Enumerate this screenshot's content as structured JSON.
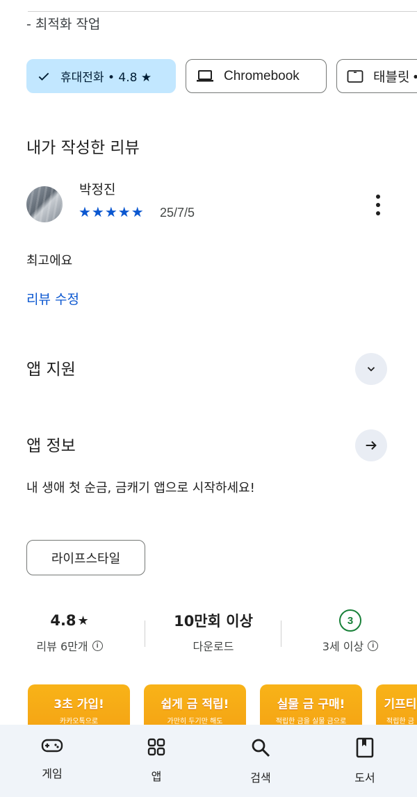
{
  "top_text": "- 최적화 작업",
  "device_chips": [
    {
      "label": "휴대전화 • 4.8 ★",
      "selected": true,
      "icon": "check-icon"
    },
    {
      "label": "Chromebook",
      "selected": false,
      "icon": "laptop-icon"
    },
    {
      "label": "태블릿 •",
      "selected": false,
      "icon": "tablet-icon"
    }
  ],
  "my_review": {
    "title": "내가 작성한 리뷰",
    "reviewer_name": "박정진",
    "stars": "★★★★★",
    "rating": 5,
    "date": "25/7/5",
    "text": "최고에요",
    "edit_label": "리뷰 수정"
  },
  "app_support": {
    "title": "앱 지원"
  },
  "app_info": {
    "title": "앱 정보",
    "description": "내 생애 첫 순금, 금캐기 앱으로 시작하세요!",
    "category_tag": "라이프스타일"
  },
  "stats": {
    "rating_value": "4.8",
    "rating_star": "★",
    "rating_label": "리뷰 6만개",
    "downloads_value": "10만회 이상",
    "downloads_label": "다운로드",
    "age_badge": "3",
    "age_label": "3세 이상"
  },
  "screenshots": [
    {
      "title": "3초 가입!",
      "subtitle": "카카오톡으로"
    },
    {
      "title": "쉽게 금 적립!",
      "subtitle": "가만히 두기만 해도"
    },
    {
      "title": "실물 금 구매!",
      "subtitle": "적립한 금을 실물 금으로"
    },
    {
      "title": "기프티",
      "subtitle": "적립한 금"
    }
  ],
  "bottom_nav": [
    {
      "label": "게임",
      "icon": "gamepad-icon"
    },
    {
      "label": "앱",
      "icon": "apps-grid-icon"
    },
    {
      "label": "검색",
      "icon": "search-icon"
    },
    {
      "label": "도서",
      "icon": "book-icon"
    }
  ],
  "colors": {
    "accent": "#0b57d0",
    "chip_selected_bg": "#c2e7ff",
    "age_green": "#188038",
    "nav_bg": "#f0f4f9",
    "screenshot_orange": "#f8b318"
  }
}
